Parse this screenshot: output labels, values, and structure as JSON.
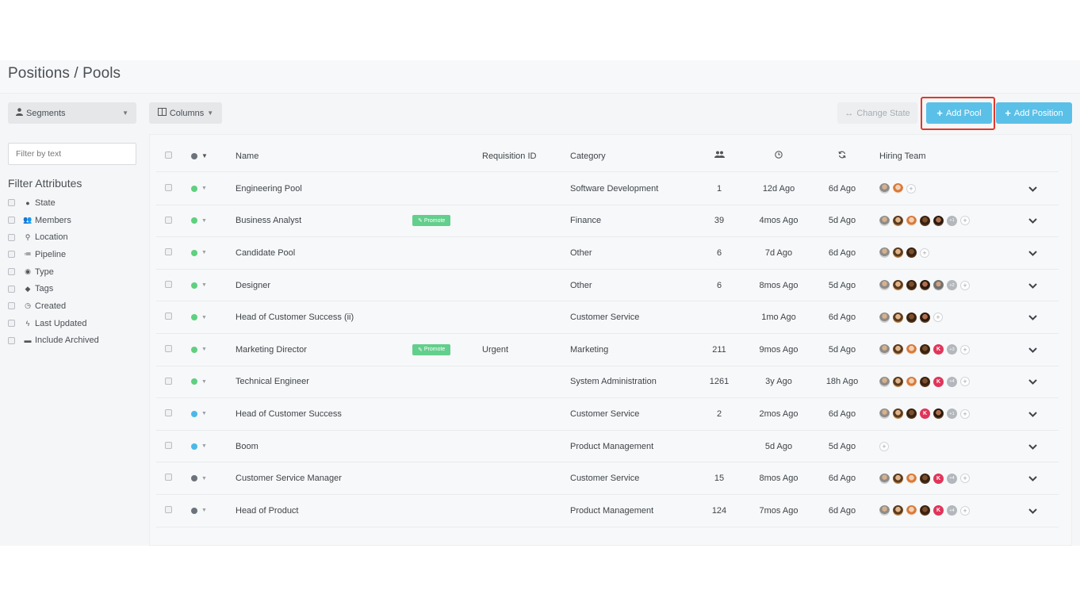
{
  "page": {
    "title": "Positions / Pools"
  },
  "sidebar": {
    "segments_label": "Segments",
    "filter_placeholder": "Filter by text",
    "attributes_title": "Filter Attributes",
    "attributes": [
      {
        "label": "State",
        "icon": "circle-icon"
      },
      {
        "label": "Members",
        "icon": "users-icon"
      },
      {
        "label": "Location",
        "icon": "location-pin-icon"
      },
      {
        "label": "Pipeline",
        "icon": "list-icon"
      },
      {
        "label": "Type",
        "icon": "user-circle-icon"
      },
      {
        "label": "Tags",
        "icon": "tag-icon"
      },
      {
        "label": "Created",
        "icon": "clock-icon"
      },
      {
        "label": "Last Updated",
        "icon": "bolt-icon"
      },
      {
        "label": "Include Archived",
        "icon": "archive-icon"
      }
    ]
  },
  "toolbar": {
    "columns_label": "Columns",
    "change_state_label": "Change State",
    "add_pool_label": "Add Pool",
    "add_position_label": "Add Position"
  },
  "table": {
    "headers": {
      "name": "Name",
      "requisition": "Requisition ID",
      "category": "Category",
      "hiring_team": "Hiring Team"
    },
    "promote_label": "Promote",
    "colors": {
      "green": "#5fd07f",
      "blue": "#4db8e8",
      "gray": "#6c737a"
    },
    "rows": [
      {
        "state": "green",
        "name": "Engineering Pool",
        "promote": false,
        "requisition": "",
        "category": "Software Development",
        "members": "1",
        "created": "12d Ago",
        "updated": "6d Ago",
        "team": [
          "a1",
          "a3"
        ],
        "extra": ""
      },
      {
        "state": "green",
        "name": "Business Analyst",
        "promote": true,
        "requisition": "",
        "category": "Finance",
        "members": "39",
        "created": "4mos Ago",
        "updated": "5d Ago",
        "team": [
          "a1",
          "a2",
          "a3",
          "a4",
          "a5"
        ],
        "extra": "+1"
      },
      {
        "state": "green",
        "name": "Candidate Pool",
        "promote": false,
        "requisition": "",
        "category": "Other",
        "members": "6",
        "created": "7d Ago",
        "updated": "6d Ago",
        "team": [
          "a1",
          "a2",
          "a4"
        ],
        "extra": ""
      },
      {
        "state": "green",
        "name": "Designer",
        "promote": false,
        "requisition": "",
        "category": "Other",
        "members": "6",
        "created": "8mos Ago",
        "updated": "5d Ago",
        "team": [
          "a1",
          "a2",
          "a4",
          "a5",
          "a6"
        ],
        "extra": "+2"
      },
      {
        "state": "green",
        "name": "Head of Customer Success (ii)",
        "promote": false,
        "requisition": "",
        "category": "Customer Service",
        "members": "",
        "created": "1mo Ago",
        "updated": "6d Ago",
        "team": [
          "a1",
          "a2",
          "a4",
          "a5"
        ],
        "extra": ""
      },
      {
        "state": "green",
        "name": "Marketing Director",
        "promote": true,
        "requisition": "Urgent",
        "category": "Marketing",
        "members": "211",
        "created": "9mos Ago",
        "updated": "5d Ago",
        "team": [
          "a1",
          "a2",
          "a3",
          "a4",
          "K"
        ],
        "extra": "+3"
      },
      {
        "state": "green",
        "name": "Technical Engineer",
        "promote": false,
        "requisition": "",
        "category": "System Administration",
        "members": "1261",
        "created": "3y Ago",
        "updated": "18h Ago",
        "team": [
          "a1",
          "a2",
          "a3",
          "a4",
          "K"
        ],
        "extra": "+4"
      },
      {
        "state": "blue",
        "name": "Head of Customer Success",
        "promote": false,
        "requisition": "",
        "category": "Customer Service",
        "members": "2",
        "created": "2mos Ago",
        "updated": "6d Ago",
        "team": [
          "a1",
          "a2",
          "a4",
          "K",
          "a5"
        ],
        "extra": "+1"
      },
      {
        "state": "blue",
        "name": "Boom",
        "promote": false,
        "requisition": "",
        "category": "Product Management",
        "members": "",
        "created": "5d Ago",
        "updated": "5d Ago",
        "team": [],
        "extra": ""
      },
      {
        "state": "gray",
        "name": "Customer Service Manager",
        "promote": false,
        "requisition": "",
        "category": "Customer Service",
        "members": "15",
        "created": "8mos Ago",
        "updated": "6d Ago",
        "team": [
          "a1",
          "a2",
          "a3",
          "a4",
          "K"
        ],
        "extra": "+4"
      },
      {
        "state": "gray",
        "name": "Head of Product",
        "promote": false,
        "requisition": "",
        "category": "Product Management",
        "members": "124",
        "created": "7mos Ago",
        "updated": "6d Ago",
        "team": [
          "a1",
          "a2",
          "a3",
          "a4",
          "K"
        ],
        "extra": "+4"
      }
    ]
  }
}
